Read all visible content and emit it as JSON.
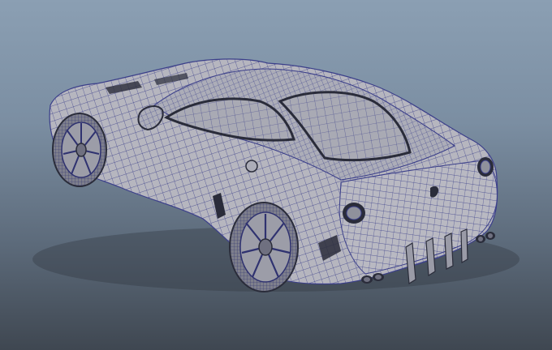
{
  "viewport": {
    "background_top": "#8b9fb3",
    "background_bottom": "#3f4751"
  },
  "model": {
    "surface_color": "#b6b6bf",
    "surface_shadow": "#8f919c",
    "wire_color": "#3b3f8a",
    "dark_trim": "#2a2c3a",
    "glass_color": "#a9aab4"
  }
}
